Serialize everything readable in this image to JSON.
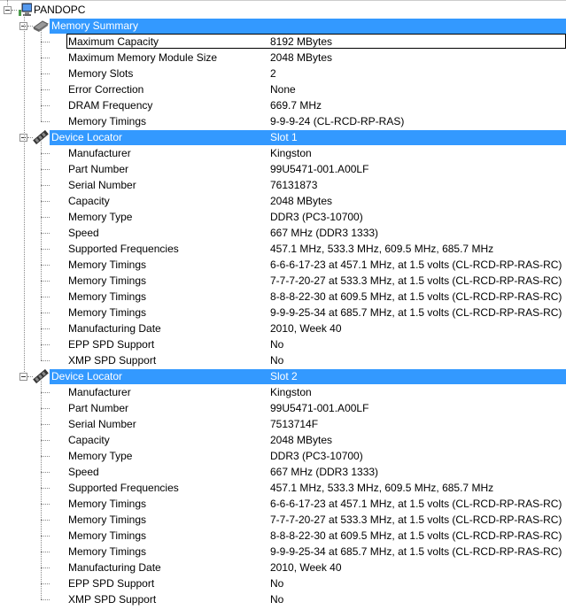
{
  "root": {
    "label": "PANDOPC",
    "icon": "computer-icon"
  },
  "sections": [
    {
      "label": "Memory Summary",
      "value": "",
      "icon": "memory-summary-icon",
      "rows": [
        {
          "label": "Maximum Capacity",
          "value": "8192 MBytes"
        },
        {
          "label": "Maximum Memory Module Size",
          "value": "2048 MBytes"
        },
        {
          "label": "Memory Slots",
          "value": "2"
        },
        {
          "label": "Error Correction",
          "value": "None"
        },
        {
          "label": "DRAM Frequency",
          "value": "669.7 MHz"
        },
        {
          "label": "Memory Timings",
          "value": "9-9-9-24 (CL-RCD-RP-RAS)"
        }
      ]
    },
    {
      "label": "Device Locator",
      "value": "Slot 1",
      "icon": "memory-module-icon",
      "rows": [
        {
          "label": "Manufacturer",
          "value": "Kingston"
        },
        {
          "label": "Part Number",
          "value": "99U5471-001.A00LF"
        },
        {
          "label": "Serial Number",
          "value": "76131873"
        },
        {
          "label": "Capacity",
          "value": "2048 MBytes"
        },
        {
          "label": "Memory Type",
          "value": "DDR3 (PC3-10700)"
        },
        {
          "label": "Speed",
          "value": "667 MHz (DDR3 1333)"
        },
        {
          "label": "Supported Frequencies",
          "value": "457.1 MHz, 533.3 MHz, 609.5 MHz, 685.7 MHz"
        },
        {
          "label": "Memory Timings",
          "value": "6-6-6-17-23 at 457.1 MHz, at 1.5 volts (CL-RCD-RP-RAS-RC)"
        },
        {
          "label": "Memory Timings",
          "value": "7-7-7-20-27 at 533.3 MHz, at 1.5 volts (CL-RCD-RP-RAS-RC)"
        },
        {
          "label": "Memory Timings",
          "value": "8-8-8-22-30 at 609.5 MHz, at 1.5 volts (CL-RCD-RP-RAS-RC)"
        },
        {
          "label": "Memory Timings",
          "value": "9-9-9-25-34 at 685.7 MHz, at 1.5 volts (CL-RCD-RP-RAS-RC)"
        },
        {
          "label": "Manufacturing Date",
          "value": "2010, Week 40"
        },
        {
          "label": "EPP SPD Support",
          "value": "No"
        },
        {
          "label": "XMP SPD Support",
          "value": "No"
        }
      ]
    },
    {
      "label": "Device Locator",
      "value": "Slot 2",
      "icon": "memory-module-icon",
      "rows": [
        {
          "label": "Manufacturer",
          "value": "Kingston"
        },
        {
          "label": "Part Number",
          "value": "99U5471-001.A00LF"
        },
        {
          "label": "Serial Number",
          "value": "7513714F"
        },
        {
          "label": "Capacity",
          "value": "2048 MBytes"
        },
        {
          "label": "Memory Type",
          "value": "DDR3 (PC3-10700)"
        },
        {
          "label": "Speed",
          "value": "667 MHz (DDR3 1333)"
        },
        {
          "label": "Supported Frequencies",
          "value": "457.1 MHz, 533.3 MHz, 609.5 MHz, 685.7 MHz"
        },
        {
          "label": "Memory Timings",
          "value": "6-6-6-17-23 at 457.1 MHz, at 1.5 volts (CL-RCD-RP-RAS-RC)"
        },
        {
          "label": "Memory Timings",
          "value": "7-7-7-20-27 at 533.3 MHz, at 1.5 volts (CL-RCD-RP-RAS-RC)"
        },
        {
          "label": "Memory Timings",
          "value": "8-8-8-22-30 at 609.5 MHz, at 1.5 volts (CL-RCD-RP-RAS-RC)"
        },
        {
          "label": "Memory Timings",
          "value": "9-9-9-25-34 at 685.7 MHz, at 1.5 volts (CL-RCD-RP-RAS-RC)"
        },
        {
          "label": "Manufacturing Date",
          "value": "2010, Week 40"
        },
        {
          "label": "EPP SPD Support",
          "value": "No"
        },
        {
          "label": "XMP SPD Support",
          "value": "No"
        }
      ]
    }
  ],
  "colors": {
    "selection": "#3399ff"
  }
}
